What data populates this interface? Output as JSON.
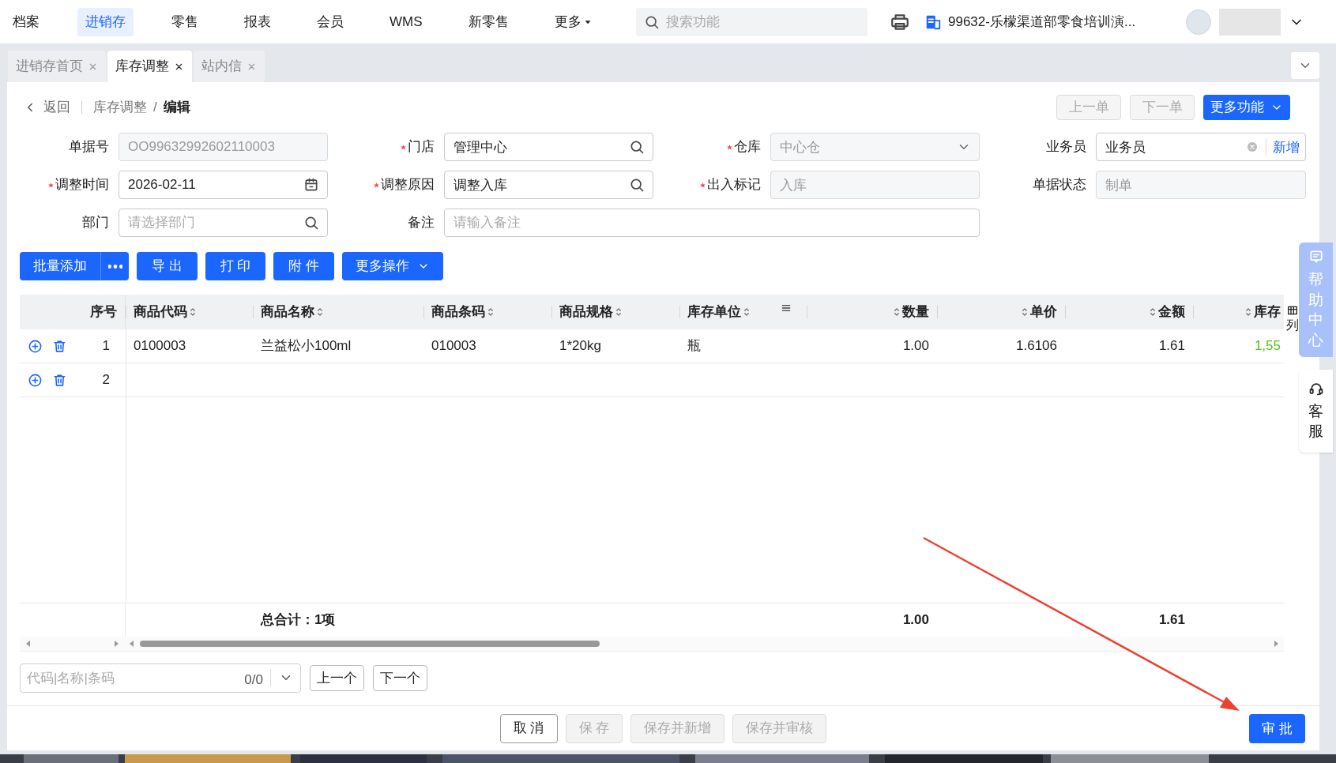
{
  "top_nav": {
    "items": [
      {
        "label": "档案",
        "selected": false
      },
      {
        "label": "进销存",
        "selected": true
      },
      {
        "label": "零售",
        "selected": false
      },
      {
        "label": "报表",
        "selected": false
      },
      {
        "label": "会员",
        "selected": false
      },
      {
        "label": "WMS",
        "selected": false
      },
      {
        "label": "新零售",
        "selected": false
      },
      {
        "label": "更多",
        "selected": false
      }
    ],
    "search": {
      "placeholder": "搜索功能"
    },
    "store": {
      "label": "99632-乐檬渠道部零食培训演..."
    }
  },
  "tabs": [
    {
      "label": "进销存首页",
      "selected": false
    },
    {
      "label": "库存调整",
      "selected": true
    },
    {
      "label": "站内信",
      "selected": false
    }
  ],
  "breadcrumb": {
    "back": "返回",
    "parent": "库存调整",
    "separator": "/",
    "current": "编辑"
  },
  "header_actions": [
    {
      "label": "上一单",
      "kind": "nav",
      "disabled": true
    },
    {
      "label": "下一单",
      "kind": "nav",
      "disabled": true
    },
    {
      "label": "更多功能",
      "kind": "dropdown",
      "disabled": false
    }
  ],
  "form": {
    "fields": [
      {
        "label": "单据号",
        "required": false,
        "kind": "text",
        "value": "OO99632992602110003",
        "disabled": true
      },
      {
        "label": "门店",
        "required": true,
        "kind": "search",
        "value": "管理中心",
        "disabled": false
      },
      {
        "label": "仓库",
        "required": true,
        "kind": "select",
        "value": "中心仓",
        "disabled": true
      },
      {
        "label": "业务员",
        "required": false,
        "kind": "clearable",
        "value": "业务员",
        "action": "新增",
        "disabled": false
      },
      {
        "label": "调整时间",
        "required": true,
        "kind": "date",
        "value": "2026-02-11",
        "disabled": false
      },
      {
        "label": "调整原因",
        "required": true,
        "kind": "search",
        "value": "调整入库",
        "disabled": false
      },
      {
        "label": "出入标记",
        "required": true,
        "kind": "text",
        "value": "入库",
        "disabled": true
      },
      {
        "label": "单据状态",
        "required": false,
        "kind": "text",
        "value": "制单",
        "disabled": true
      },
      {
        "label": "部门",
        "required": false,
        "kind": "search",
        "placeholder": "请选择部门",
        "disabled": false
      },
      {
        "label": "备注",
        "required": false,
        "kind": "wide",
        "placeholder": "请输入备注",
        "disabled": false
      }
    ]
  },
  "toolbar": [
    {
      "label": "批量添加",
      "kind": "split"
    },
    {
      "label": "导 出",
      "kind": "plain"
    },
    {
      "label": "打 印",
      "kind": "plain"
    },
    {
      "label": "附 件",
      "kind": "plain"
    },
    {
      "label": "更多操作",
      "kind": "dropdown"
    }
  ],
  "table": {
    "columns": [
      {
        "label": "序号",
        "sortable": false,
        "filterable": false
      },
      {
        "label": "商品代码",
        "sortable": true,
        "filterable": false
      },
      {
        "label": "商品名称",
        "sortable": true,
        "filterable": false
      },
      {
        "label": "商品条码",
        "sortable": true,
        "filterable": false
      },
      {
        "label": "商品规格",
        "sortable": true,
        "filterable": false
      },
      {
        "label": "库存单位",
        "sortable": true,
        "filterable": true
      },
      {
        "label": "数量",
        "sortable": true,
        "filterable": false
      },
      {
        "label": "单价",
        "sortable": true,
        "filterable": false
      },
      {
        "label": "金额",
        "sortable": true,
        "filterable": false
      },
      {
        "label": "库存",
        "sortable": true,
        "filterable": false
      }
    ],
    "rows": [
      {
        "cells": [
          "1",
          "0100003",
          "兰益松小100ml",
          "010003",
          "1*20kg",
          "瓶",
          "1.00",
          "1.6106",
          "1.61",
          "1,55"
        ]
      },
      {
        "cells": [
          "2"
        ]
      }
    ],
    "summary": {
      "label": "总合计：1项",
      "quantity": "1.00",
      "amount": "1.61"
    },
    "column_settings": "列"
  },
  "find_bar": {
    "placeholder": "代码|名称|条码",
    "count": "0/0",
    "prev": "上一个",
    "next": "下一个"
  },
  "footer": [
    {
      "label": "取 消",
      "kind": "default"
    },
    {
      "label": "保 存",
      "kind": "disabled"
    },
    {
      "label": "保存并新增",
      "kind": "disabled"
    },
    {
      "label": "保存并审核",
      "kind": "disabled"
    },
    {
      "label": "审 批",
      "kind": "primary"
    }
  ],
  "side_panel": [
    {
      "label": "帮助中心",
      "kind": "primary"
    },
    {
      "label": "客服",
      "kind": "plain"
    }
  ]
}
